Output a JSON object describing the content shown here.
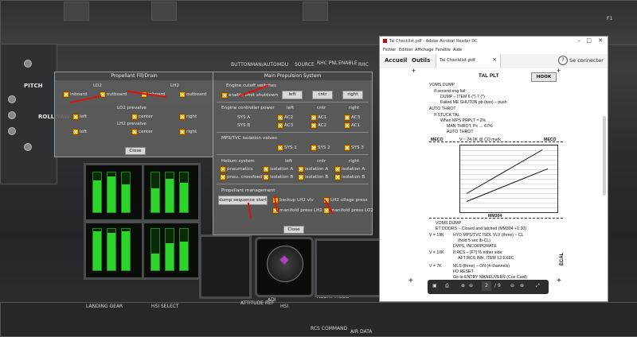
{
  "cockpit": {
    "labels": [
      "PITCH",
      "ROLL/YAW",
      "LANDING GEAR",
      "HSI SELECT",
      "ABORT MODE",
      "RCS COMMAND",
      "AIR DATA",
      "ATTITUDE REF",
      "HSI",
      "ADI",
      "ADI",
      "F1",
      "F2"
    ],
    "panel_top": [
      "BUTTON",
      "MAN/AUTO",
      "MDU",
      "SOURCE",
      "RHC PNL",
      "ENABLE",
      "RHC",
      "TRIM"
    ]
  },
  "dialog_fill": {
    "title": "Propellant Fill/Drain",
    "lo2": "LO2",
    "lh2": "LH2",
    "row1": [
      "inboard",
      "outboard",
      "inboard",
      "outboard"
    ],
    "lo2_prevalve": "LO2 prevalve",
    "lh2_prevalve": "LH2 prevalve",
    "prevalve_opts": [
      "left",
      "center",
      "right"
    ],
    "close": "Close"
  },
  "dialog_mps": {
    "title": "Main Propulsion System",
    "engine_cutoff": "Engine cutoff switches",
    "enable_limit": "enable limit shutdown",
    "btn_left": "left",
    "btn_cntr": "cntr",
    "btn_right": "right",
    "engine_power": "Engine controller power",
    "col_left": "left",
    "col_cntr": "cntr",
    "col_right": "right",
    "sys_a": "SYS A",
    "sys_b": "SYS B",
    "ac_a": [
      "AC2",
      "AC1",
      "AC3"
    ],
    "ac_b": [
      "AC3",
      "AC2",
      "AC1"
    ],
    "isolation_header": "MPS/TVC isolation valves",
    "sys_opts": [
      "SYS 1",
      "SYS 2",
      "SYS 3"
    ],
    "helium_system": "Helium system",
    "pneumatics": "pneumatics",
    "pneu_crossfeed": "pneu. crossfeed",
    "isoA": "isolation A",
    "isoB": "isolation B",
    "prop_mgmt": "Propellant management",
    "dump_seq": "dump sequence start",
    "backup_lh2": "backup LH2 vlv",
    "lh2_ullage": "LH2 ullage press",
    "manifold_lh2": "manifold press LH2",
    "manifold_lo2": "manifold press LO2",
    "close": "Close"
  },
  "pdf": {
    "window_title": "Tal Checklist.pdf - Adobe Acrobat Reader DC",
    "menu": [
      "Fichier",
      "Edition",
      "Affichage",
      "Fenêtre",
      "Aide"
    ],
    "tabs": [
      "Accueil",
      "Outils",
      "Tal Checklist.pdf"
    ],
    "tab_close": "×",
    "help": "?",
    "connect": "Se connecter",
    "heading": "TAL PLT",
    "hook_btn": "HOOK",
    "lines": [
      "VOMS DUMP",
      "If second eng fail:",
      "DUMP – ITEM 6 (*) 7 (*)",
      "Failed ME SHUTDN pb (two) – push",
      "AUTO THROT",
      "If STUCK TAL",
      "When MPS PRPLT ≈ 2%",
      "MAN THROT, Pc → 67%",
      "AUTO THROT"
    ],
    "meco_left": "MECO",
    "meco_right": "MECO",
    "meco_center": "V ~ 24.0K @ CO mark",
    "mm304": "MM304",
    "post_lines": [
      "VOMS DUMP",
      "ET DOORS – Closed and latched (MM304 +1:30)",
      "HYD MPS/TVC ISOL VLV (three) – CL",
      "(hold 5 sec ib-CL)",
      "DVPS, INCORPORATE",
      "If RCS – [F?] % either side:",
      "AFT RCS INH, ITEM 13 EXEC",
      "MLS (three) – ON (4 channels)",
      "I/O RESET",
      "Go to ENTRY MANEUVERS (Cue Card)"
    ],
    "v_labels": [
      "V = 19K",
      "V = 10K",
      "V = 7K"
    ],
    "ecal": "ECAL",
    "page_current": "2",
    "page_total": "/ 9"
  },
  "colors": {
    "checkbox": "#f0a000",
    "arrow": "#e01010",
    "mfd_green": "#2cd42c"
  },
  "icons": [
    "save-icon",
    "print-icon",
    "page-up-icon",
    "page-down-icon",
    "zoom-out-icon",
    "zoom-in-icon",
    "fullscreen-icon"
  ]
}
